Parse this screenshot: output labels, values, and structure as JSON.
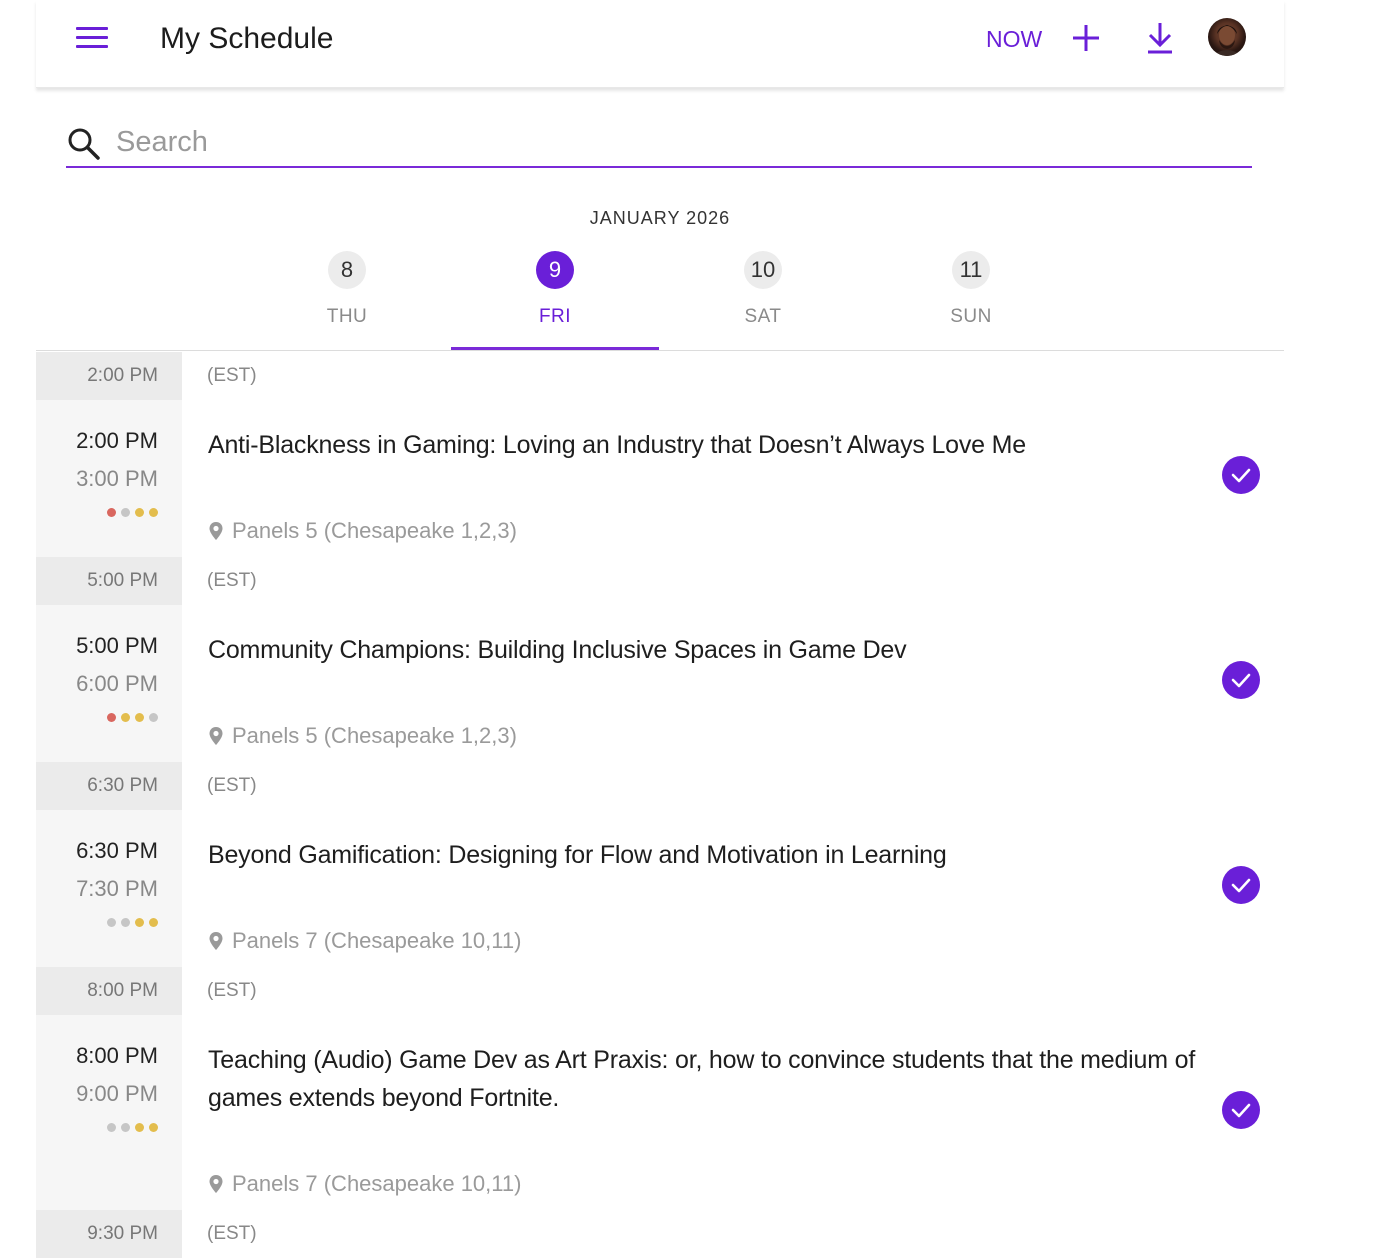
{
  "header": {
    "title": "My Schedule",
    "now_label": "NOW"
  },
  "search": {
    "placeholder": "Search"
  },
  "calendar": {
    "month": "JANUARY 2026",
    "days": [
      {
        "num": "8",
        "dow": "THU",
        "active": false
      },
      {
        "num": "9",
        "dow": "FRI",
        "active": true
      },
      {
        "num": "10",
        "dow": "SAT",
        "active": false
      },
      {
        "num": "11",
        "dow": "SUN",
        "active": false
      }
    ]
  },
  "colors": {
    "accent": "#6a1fd8",
    "dot_red": "#d9675f",
    "dot_gold": "#e3bd4d",
    "dot_grey": "#c6c6c6"
  },
  "schedule": [
    {
      "slot": "2:00 PM",
      "tz": "(EST)",
      "start": "2:00 PM",
      "end": "3:00 PM",
      "title": "Anti-Blackness in Gaming: Loving an Industry that Doesn’t Always Love Me",
      "location": "Panels 5 (Chesapeake 1,2,3)",
      "dots": [
        "red",
        "grey",
        "gold",
        "gold"
      ]
    },
    {
      "slot": "5:00 PM",
      "tz": "(EST)",
      "start": "5:00 PM",
      "end": "6:00 PM",
      "title": "Community Champions: Building Inclusive Spaces in Game Dev",
      "location": "Panels 5 (Chesapeake 1,2,3)",
      "dots": [
        "red",
        "gold",
        "gold",
        "grey"
      ]
    },
    {
      "slot": "6:30 PM",
      "tz": "(EST)",
      "start": "6:30 PM",
      "end": "7:30 PM",
      "title": "Beyond Gamification: Designing for Flow and Motivation in Learning",
      "location": "Panels 7 (Chesapeake 10,11)",
      "dots": [
        "grey",
        "grey",
        "gold",
        "gold"
      ]
    },
    {
      "slot": "8:00 PM",
      "tz": "(EST)",
      "start": "8:00 PM",
      "end": "9:00 PM",
      "title": "Teaching (Audio) Game Dev as Art Praxis: or, how to convince students that the medium of games extends beyond Fortnite.",
      "location": "Panels 7 (Chesapeake 10,11)",
      "dots": [
        "grey",
        "grey",
        "gold",
        "gold"
      ]
    }
  ],
  "trailing_slot": {
    "slot": "9:30 PM",
    "tz": "(EST)"
  }
}
